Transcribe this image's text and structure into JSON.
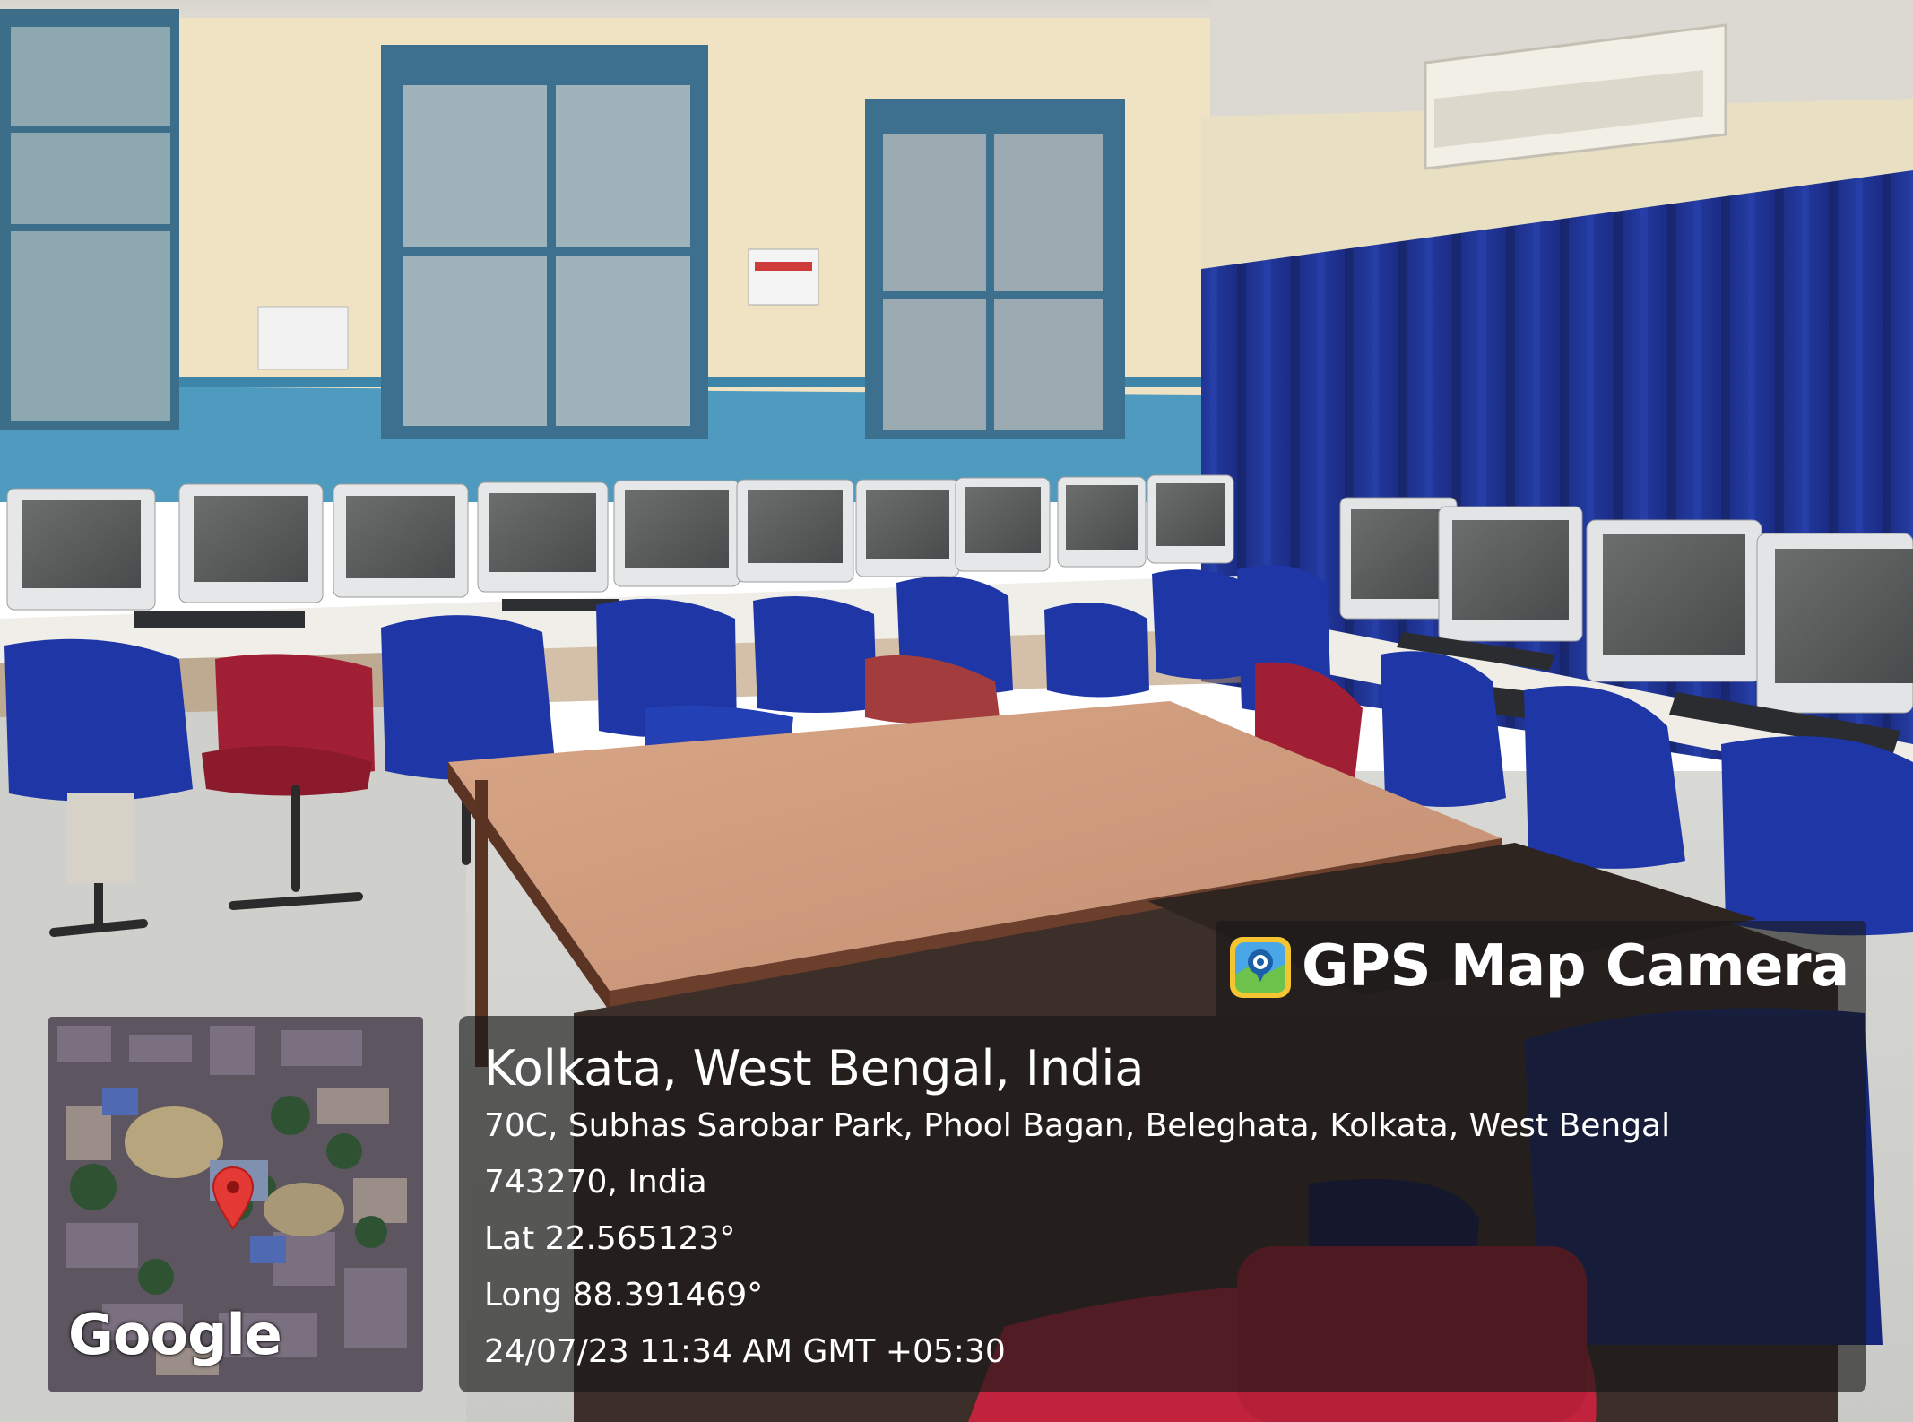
{
  "overlay": {
    "app_name": "GPS Map Camera",
    "icon": "gps-map-camera-app-icon",
    "location_title": "Kolkata, West Bengal, India",
    "address_line_1": "70C, Subhas Sarobar Park, Phool Bagan, Beleghata, Kolkata, West Bengal",
    "address_line_2": "743270, India",
    "latitude": "Lat 22.565123°",
    "longitude": "Long 88.391469°",
    "timestamp": "24/07/23 11:34 AM GMT +05:30"
  },
  "minimap": {
    "provider_logo": "Google",
    "pin_icon": "map-pin-icon",
    "pin_color": "#e53935"
  },
  "colors": {
    "curtain": "#1d2f8c",
    "chair_blue": "#1f37a6",
    "chair_red": "#a11f35",
    "wall_blue": "#4f9bbf",
    "wall_cream": "#efe3c4"
  }
}
